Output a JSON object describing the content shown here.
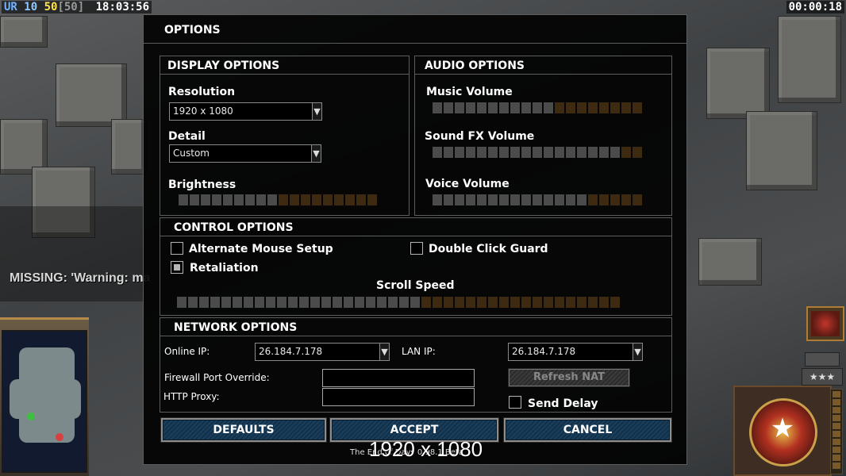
{
  "hud": {
    "ur": "UR",
    "n1": "10",
    "n2": "50",
    "n3": "[50]",
    "clock": "18:03:56",
    "game_timer": "00:00:18"
  },
  "background_message": "MISSING: 'Warning: ma",
  "dialog": {
    "title": "OPTIONS",
    "display": {
      "heading": "DISPLAY OPTIONS",
      "resolution_label": "Resolution",
      "resolution_value": "1920 x 1080",
      "detail_label": "Detail",
      "detail_value": "Custom",
      "brightness_label": "Brightness",
      "brightness_level": 9,
      "brightness_total": 18
    },
    "audio": {
      "heading": "AUDIO OPTIONS",
      "music_label": "Music Volume",
      "music_level": 11,
      "music_total": 19,
      "sfx_label": "Sound FX Volume",
      "sfx_level": 17,
      "sfx_total": 19,
      "voice_label": "Voice Volume",
      "voice_level": 14,
      "voice_total": 19
    },
    "control": {
      "heading": "CONTROL OPTIONS",
      "alt_mouse_label": "Alternate Mouse Setup",
      "alt_mouse_checked": false,
      "double_click_label": "Double Click Guard",
      "double_click_checked": false,
      "retaliation_label": "Retaliation",
      "retaliation_checked": true,
      "scroll_label": "Scroll Speed",
      "scroll_level": 22,
      "scroll_total": 40
    },
    "network": {
      "heading": "NETWORK OPTIONS",
      "online_ip_label": "Online IP:",
      "online_ip_value": "26.184.7.178",
      "lan_ip_label": "LAN IP:",
      "lan_ip_value": "26.184.7.178",
      "firewall_label": "Firewall Port Override:",
      "firewall_value": "",
      "proxy_label": "HTTP Proxy:",
      "proxy_value": "",
      "refresh_label": "Refresh NAT",
      "send_delay_label": "Send Delay",
      "send_delay_checked": false
    },
    "buttons": {
      "defaults": "DEFAULTS",
      "accept": "ACCEPT",
      "cancel": "CANCEL"
    },
    "version_text": "The End of Days 0.98.1 Beta",
    "resolution_overlay": "1920 x 1080"
  },
  "colors": {
    "slider_on": "#4b4b4b",
    "slider_off": "#3d2a10",
    "button_fill": "#1a3f5c",
    "hud_yellow": "#ffe34a",
    "hud_blue": "#6fb3ff"
  }
}
